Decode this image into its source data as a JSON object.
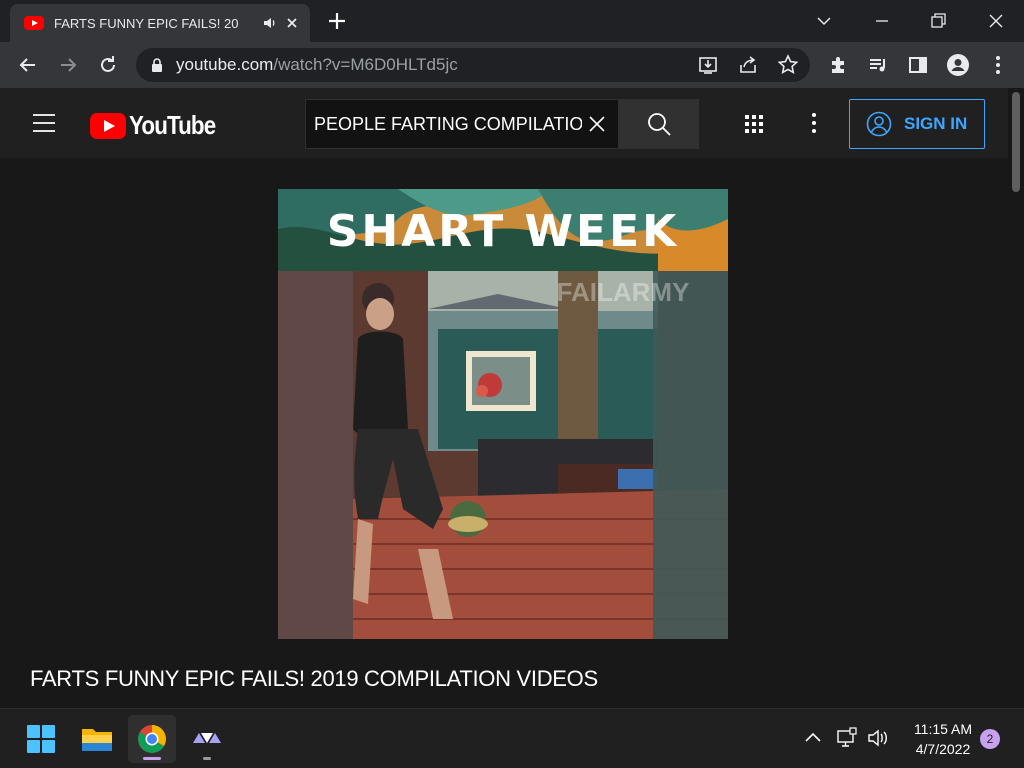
{
  "browser": {
    "tab": {
      "title": "FARTS FUNNY EPIC FAILS! 20",
      "audio_icon": "speaker-icon",
      "close_icon": "close-icon"
    },
    "new_tab_icon": "plus-icon",
    "window_controls": [
      "chevron-down-icon",
      "minimize-icon",
      "restore-icon",
      "close-icon"
    ],
    "address": {
      "host": "youtube.com",
      "path": "/watch?v=M6D0HLTd5jc"
    },
    "toolbar_icons": [
      "back-icon",
      "forward-icon",
      "reload-icon",
      "lock-icon",
      "install-icon",
      "share-icon",
      "star-icon",
      "extensions-icon",
      "media-icon",
      "sidepanel-icon",
      "profile-icon",
      "menu-icon"
    ]
  },
  "youtube": {
    "logo_text": "YouTube",
    "search": {
      "value": "PEOPLE FARTING COMPILATIO"
    },
    "sign_in": "SIGN IN",
    "video": {
      "banner_text": "SHART WEEK",
      "watermark": "FAILARMY",
      "title": "FARTS FUNNY EPIC FAILS! 2019 COMPILATION VIDEOS"
    }
  },
  "taskbar": {
    "apps": [
      "windows-start-icon",
      "file-explorer-icon",
      "chrome-icon",
      "app-icon"
    ],
    "clock": {
      "time": "11:15 AM",
      "date": "4/7/2022"
    },
    "notifications": "2"
  }
}
